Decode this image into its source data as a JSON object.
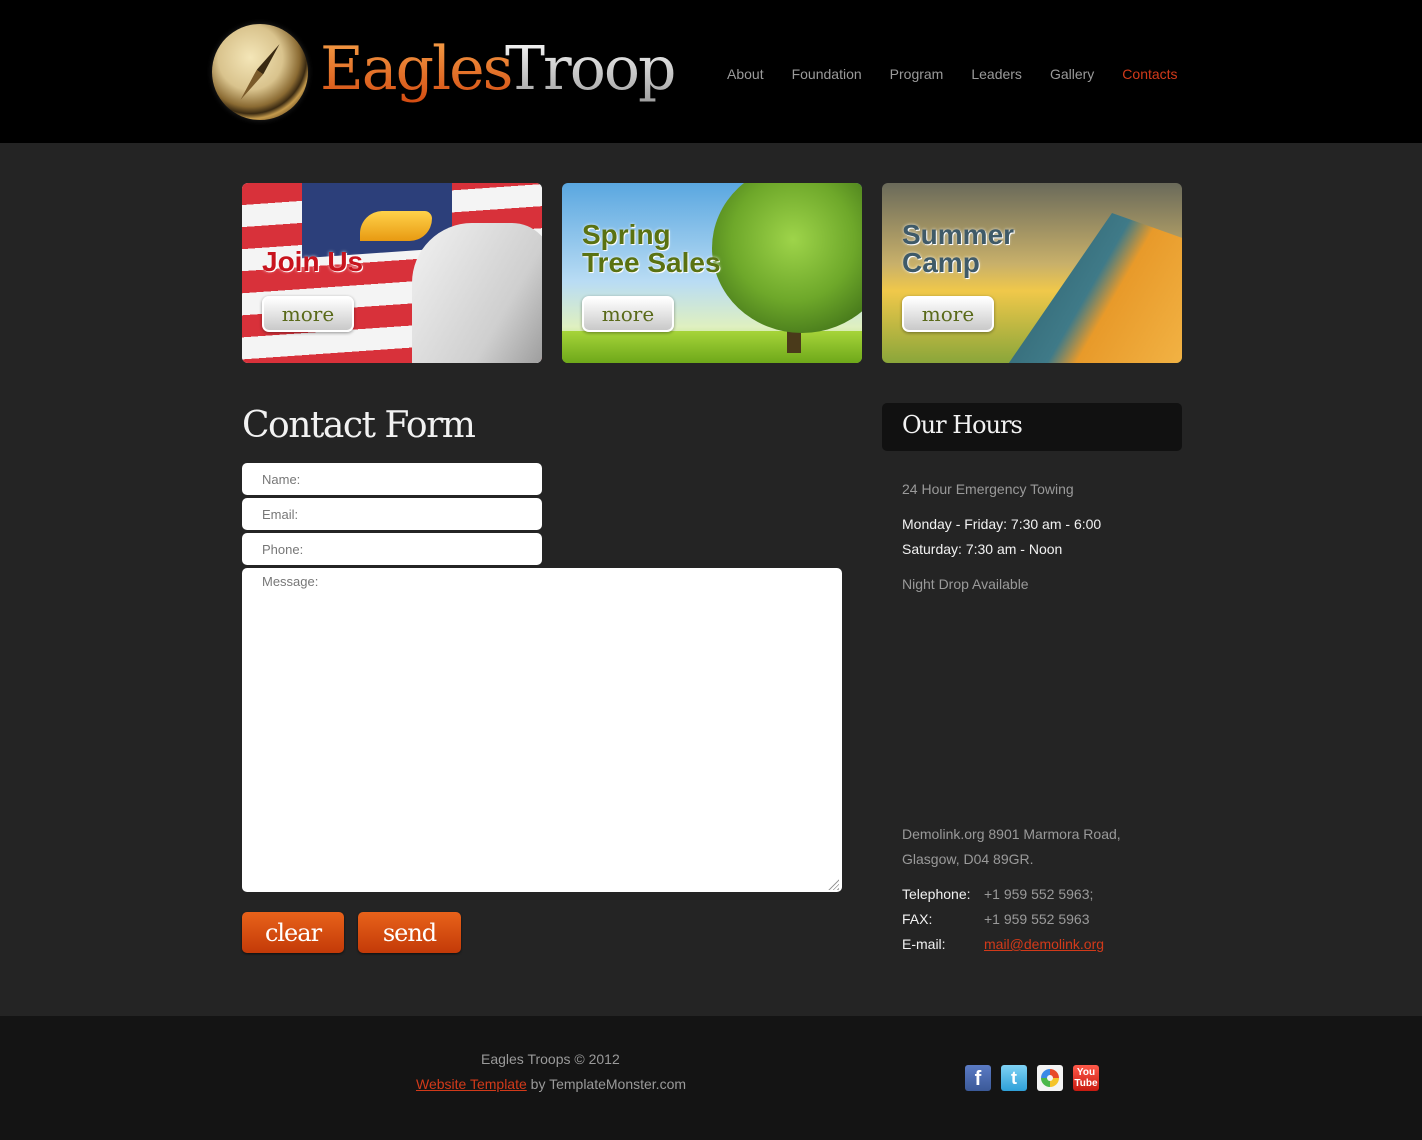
{
  "site": {
    "logo_word_1": "Eagles",
    "logo_word_2": "Troop",
    "brand_color": "#e8621a",
    "accent_link_color": "#d23a1a"
  },
  "nav": {
    "items": [
      {
        "label": "About"
      },
      {
        "label": "Foundation"
      },
      {
        "label": "Program"
      },
      {
        "label": "Leaders"
      },
      {
        "label": "Gallery"
      },
      {
        "label": "Contacts",
        "active": true
      }
    ]
  },
  "banners": [
    {
      "title_line_1": "Join Us",
      "title_line_2": "",
      "button_label": "more",
      "title_color": "#c8141e"
    },
    {
      "title_line_1": "Spring",
      "title_line_2": "Tree Sales",
      "button_label": "more",
      "title_color": "#5a7212"
    },
    {
      "title_line_1": "Summer",
      "title_line_2": "Camp",
      "button_label": "more",
      "title_color": "#3f5a68"
    }
  ],
  "contact_form": {
    "heading": "Contact Form",
    "name_placeholder": "Name:",
    "email_placeholder": "Email:",
    "phone_placeholder": "Phone:",
    "message_placeholder": "Message:",
    "clear_label": "clear",
    "send_label": "send"
  },
  "hours": {
    "heading": "Our Hours",
    "line_1": "24 Hour Emergency Towing",
    "line_2": "Monday - Friday: 7:30 am - 6:00",
    "line_3": "Saturday: 7:30 am - Noon",
    "line_4": "Night Drop Available",
    "address_line_1": "Demolink.org 8901 Marmora Road,",
    "address_line_2": "Glasgow, D04 89GR.",
    "telephone_label": "Telephone:",
    "telephone_value": "+1 959 552 5963;",
    "fax_label": "FAX:",
    "fax_value": "+1 959 552 5963",
    "email_label": "E-mail:",
    "email_value": "mail@demolink.org"
  },
  "footer": {
    "copyright": "Eagles Troops © 2012",
    "credit_link": "Website Template",
    "credit_suffix": " by TemplateMonster.com",
    "social": [
      {
        "icon": "facebook-icon",
        "glyph": "f"
      },
      {
        "icon": "twitter-icon",
        "glyph": "t"
      },
      {
        "icon": "picasa-icon",
        "glyph": ""
      },
      {
        "icon": "youtube-icon",
        "glyph": "You Tube"
      }
    ]
  }
}
